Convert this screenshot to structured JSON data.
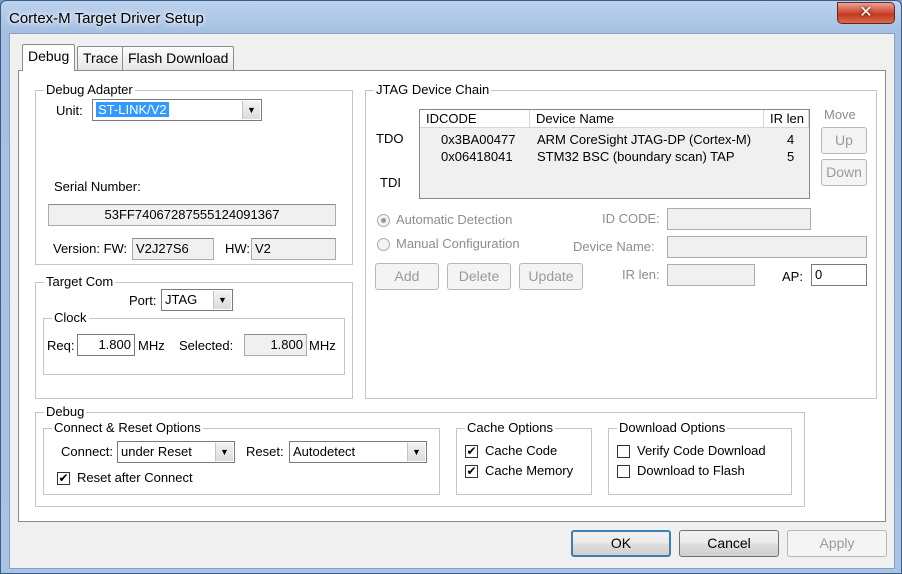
{
  "window": {
    "title": "Cortex-M Target Driver Setup",
    "close_glyph": "✕"
  },
  "tabs": [
    {
      "label": "Debug",
      "active": true
    },
    {
      "label": "Trace",
      "active": false
    },
    {
      "label": "Flash Download",
      "active": false
    }
  ],
  "debug_adapter": {
    "legend": "Debug Adapter",
    "unit_label": "Unit:",
    "unit_value": "ST-LINK/V2",
    "serial_label": "Serial Number:",
    "serial_value": "53FF74067287555124091367",
    "version_label": "Version: FW:",
    "fw_value": "V2J27S6",
    "hw_label": "HW:",
    "hw_value": "V2"
  },
  "target_com": {
    "legend": "Target Com",
    "port_label": "Port:",
    "port_value": "JTAG",
    "clock_legend": "Clock",
    "req_label": "Req:",
    "req_value": "1.800",
    "mhz": "MHz",
    "selected_label": "Selected:",
    "selected_value": "1.800"
  },
  "jtag_chain": {
    "legend": "JTAG Device Chain",
    "columns": [
      "IDCODE",
      "Device Name",
      "IR len"
    ],
    "rows": [
      {
        "idcode": "0x3BA00477",
        "name": "ARM CoreSight JTAG-DP (Cortex-M)",
        "irlen": "4"
      },
      {
        "idcode": "0x06418041",
        "name": "STM32 BSC (boundary scan) TAP",
        "irlen": "5"
      }
    ],
    "tdo": "TDO",
    "tdi": "TDI",
    "move_label": "Move",
    "up_label": "Up",
    "down_label": "Down",
    "auto_detect": "Automatic Detection",
    "manual_config": "Manual Configuration",
    "id_code_label": "ID CODE:",
    "device_name_label": "Device Name:",
    "ir_len_label": "IR len:",
    "ap_label": "AP:",
    "ap_value": "0",
    "add_label": "Add",
    "delete_label": "Delete",
    "update_label": "Update"
  },
  "debug_section": {
    "legend": "Debug",
    "connect_reset": {
      "legend": "Connect & Reset Options",
      "connect_label": "Connect:",
      "connect_value": "under Reset",
      "reset_label": "Reset:",
      "reset_value": "Autodetect",
      "reset_after_connect": "Reset after Connect",
      "reset_after_connect_checked": true
    },
    "cache": {
      "legend": "Cache Options",
      "cache_code": "Cache Code",
      "cache_code_checked": true,
      "cache_memory": "Cache Memory",
      "cache_memory_checked": true
    },
    "download": {
      "legend": "Download Options",
      "verify": "Verify Code Download",
      "verify_checked": false,
      "to_flash": "Download to Flash",
      "to_flash_checked": false
    }
  },
  "footer": {
    "ok": "OK",
    "cancel": "Cancel",
    "apply": "Apply"
  },
  "glyphs": {
    "check": "✔",
    "combo_arrow": "▼"
  }
}
